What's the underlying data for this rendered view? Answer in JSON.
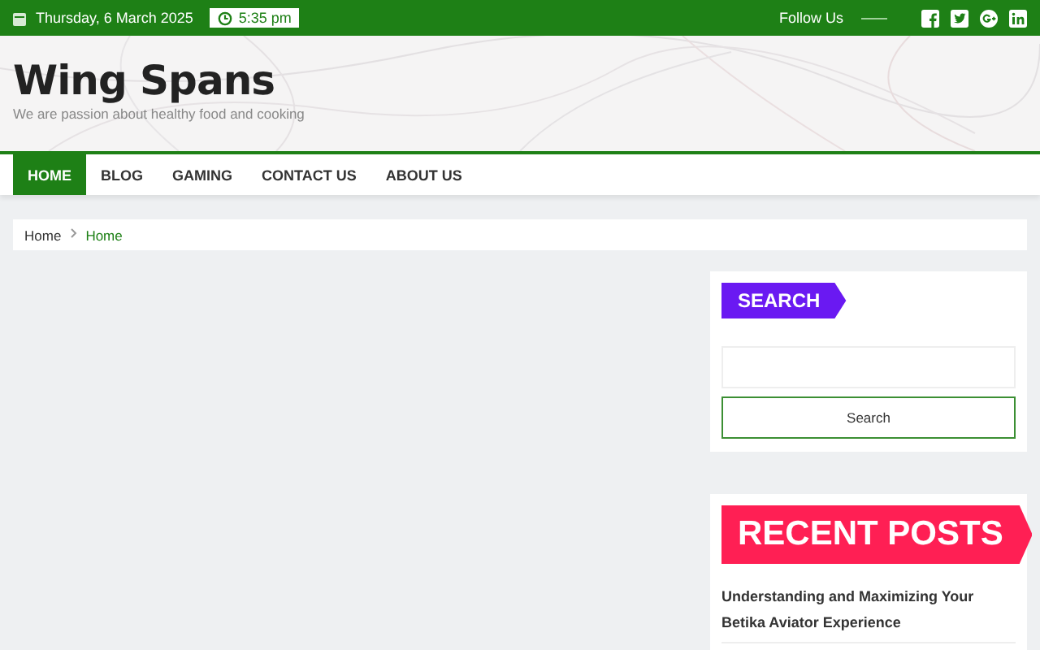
{
  "top_bar": {
    "date": "Thursday, 6 March 2025",
    "time": "5:35 pm",
    "follow_label": "Follow Us"
  },
  "header": {
    "site_title": "Wing Spans",
    "tagline": "We are passion about healthy food and cooking"
  },
  "nav": [
    {
      "label": "HOME",
      "selected": true
    },
    {
      "label": "BLOG",
      "selected": false
    },
    {
      "label": "GAMING",
      "selected": false
    },
    {
      "label": "CONTACT US",
      "selected": false
    },
    {
      "label": "ABOUT US",
      "selected": false
    }
  ],
  "breadcrumb": [
    "Home",
    "Home"
  ],
  "sidebar": {
    "search_widget": {
      "title": "SEARCH",
      "button": "Search"
    },
    "recent_posts": {
      "title": "RECENT POSTS",
      "posts": [
        "Understanding and Maximizing Your Betika Aviator Experience"
      ]
    }
  }
}
